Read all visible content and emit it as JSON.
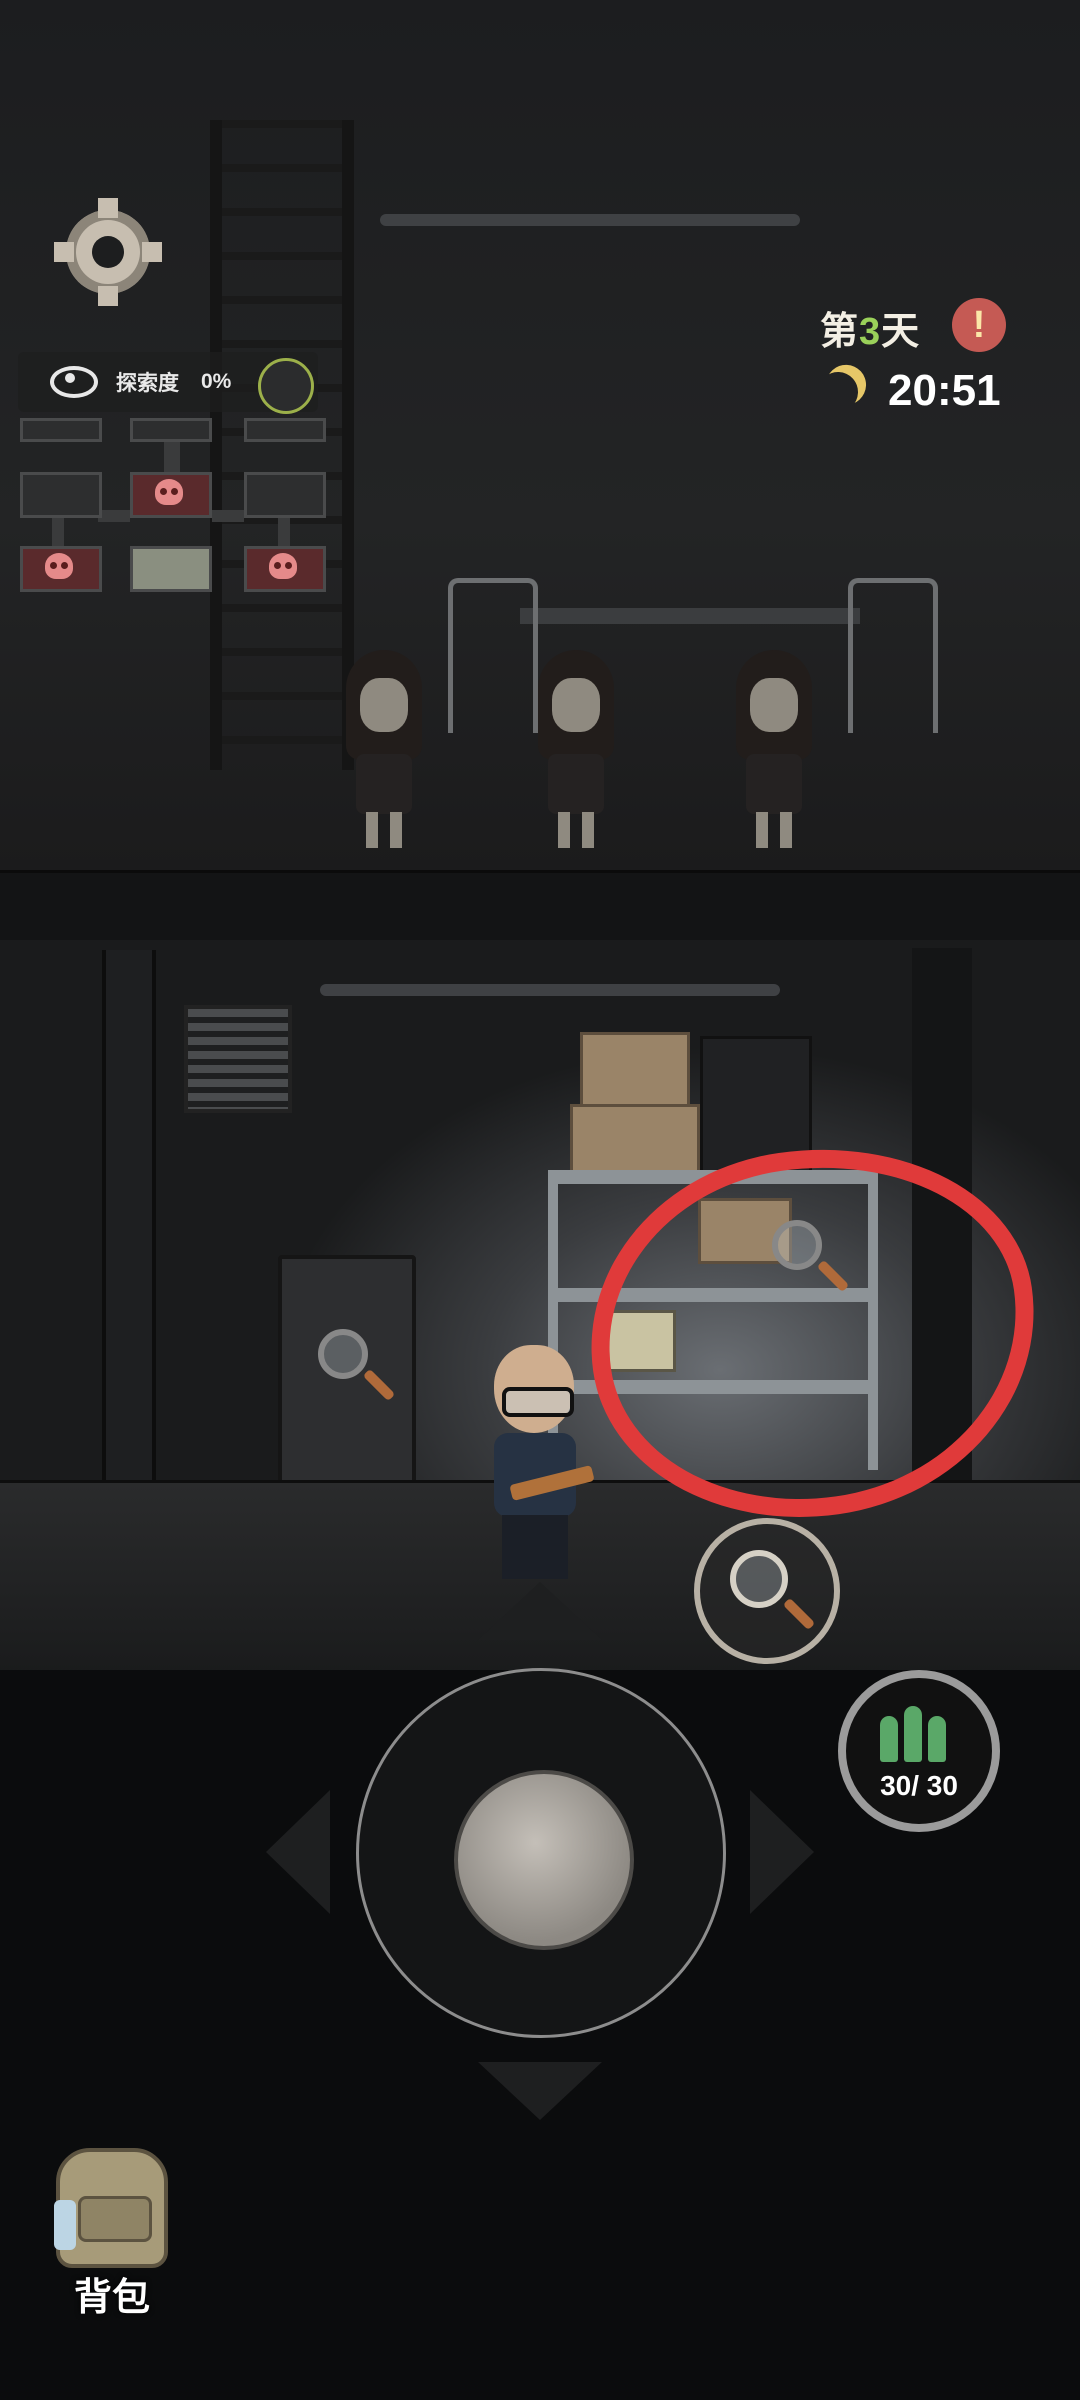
{
  "hud": {
    "explore_label": "探索度",
    "explore_percent": "0%",
    "day_prefix": "第",
    "day_number": "3",
    "day_suffix": "天",
    "alert_symbol": "!",
    "time": "20:51"
  },
  "controls": {
    "ammo": "30/ 30",
    "backpack_label": "背包"
  },
  "colors": {
    "annotation": "#e03a3a",
    "day_number": "#9ad15a",
    "alert": "#c55a54",
    "bullet": "#5aa868"
  },
  "icons": [
    "gear-icon",
    "eye-icon",
    "exit-icon",
    "moon-icon",
    "alert-icon",
    "magnifier-icon",
    "bullet-icon",
    "backpack-icon"
  ]
}
